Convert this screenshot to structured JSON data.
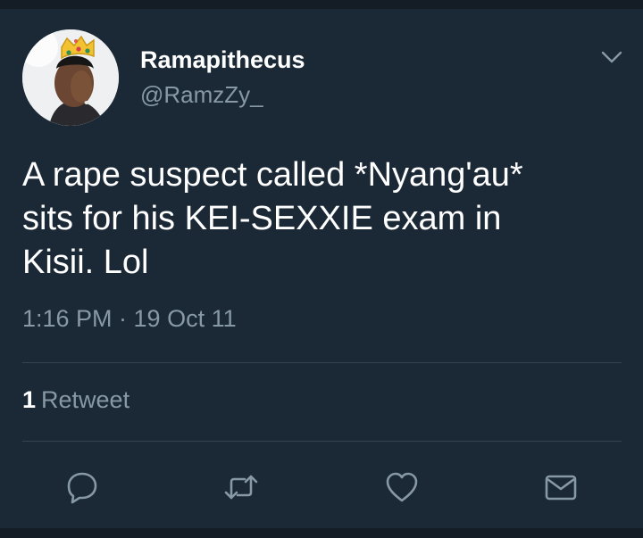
{
  "user": {
    "display_name": "Ramapithecus",
    "handle": "@RamzZy_",
    "avatar_icon": "avatar-with-crown"
  },
  "menu_icon": "chevron-down-icon",
  "tweet": {
    "lines": [
      "A rape suspect called *Nyang'au*",
      "sits for his KEI-SEXXIE exam in",
      "Kisii. Lol"
    ],
    "timestamp": "1:16 PM · 19 Oct 11"
  },
  "stats": {
    "retweet_count": "1",
    "retweet_label": "Retweet"
  },
  "actions": [
    {
      "name": "reply",
      "icon": "reply-bubble-icon"
    },
    {
      "name": "retweet",
      "icon": "retweet-arrows-icon"
    },
    {
      "name": "like",
      "icon": "heart-icon"
    },
    {
      "name": "share",
      "icon": "envelope-icon"
    }
  ],
  "colors": {
    "background": "#1b2836",
    "frame": "#141d26",
    "text_primary": "#ffffff",
    "text_secondary": "#8899a6",
    "divider": "#38444d"
  }
}
